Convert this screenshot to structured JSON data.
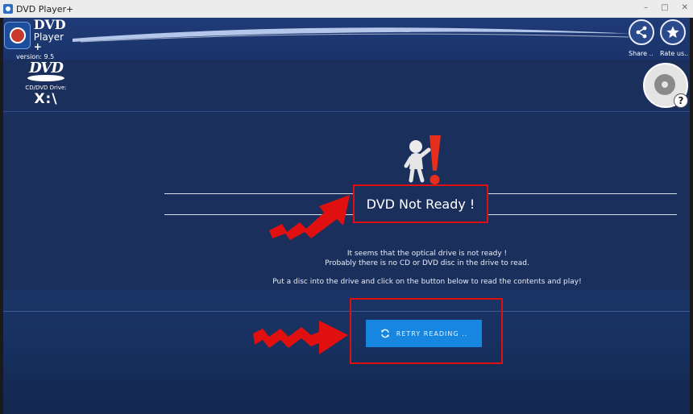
{
  "window": {
    "title": "DVD Player+",
    "minimize": "–",
    "maximize": "□",
    "close": "✕"
  },
  "header": {
    "logo_dvd": "DVD",
    "logo_player": "Player",
    "logo_plus": "+",
    "version": "version: 9.5",
    "share_label": "Share ..",
    "rate_label": "Rate us.."
  },
  "drive": {
    "logo": "DVD",
    "label": "CD/DVD Drive:",
    "letter": "X:\\"
  },
  "help": {
    "symbol": "?"
  },
  "main": {
    "title": "DVD Not Ready !",
    "msg_line1": "It seems that the optical drive is not ready !",
    "msg_line2": "Probably there is no CD or DVD disc in the drive to read.",
    "msg_line3": "Put a disc into the drive and click on the button below to read the contents and play!",
    "retry_label": "RETRY READING .."
  },
  "colors": {
    "background": "#1b2f5c",
    "accent": "#1786e0",
    "highlight_red": "#e01010"
  },
  "icons": {
    "share": "share-icon",
    "rate": "star-icon",
    "help": "help-icon",
    "retry": "refresh-icon"
  }
}
